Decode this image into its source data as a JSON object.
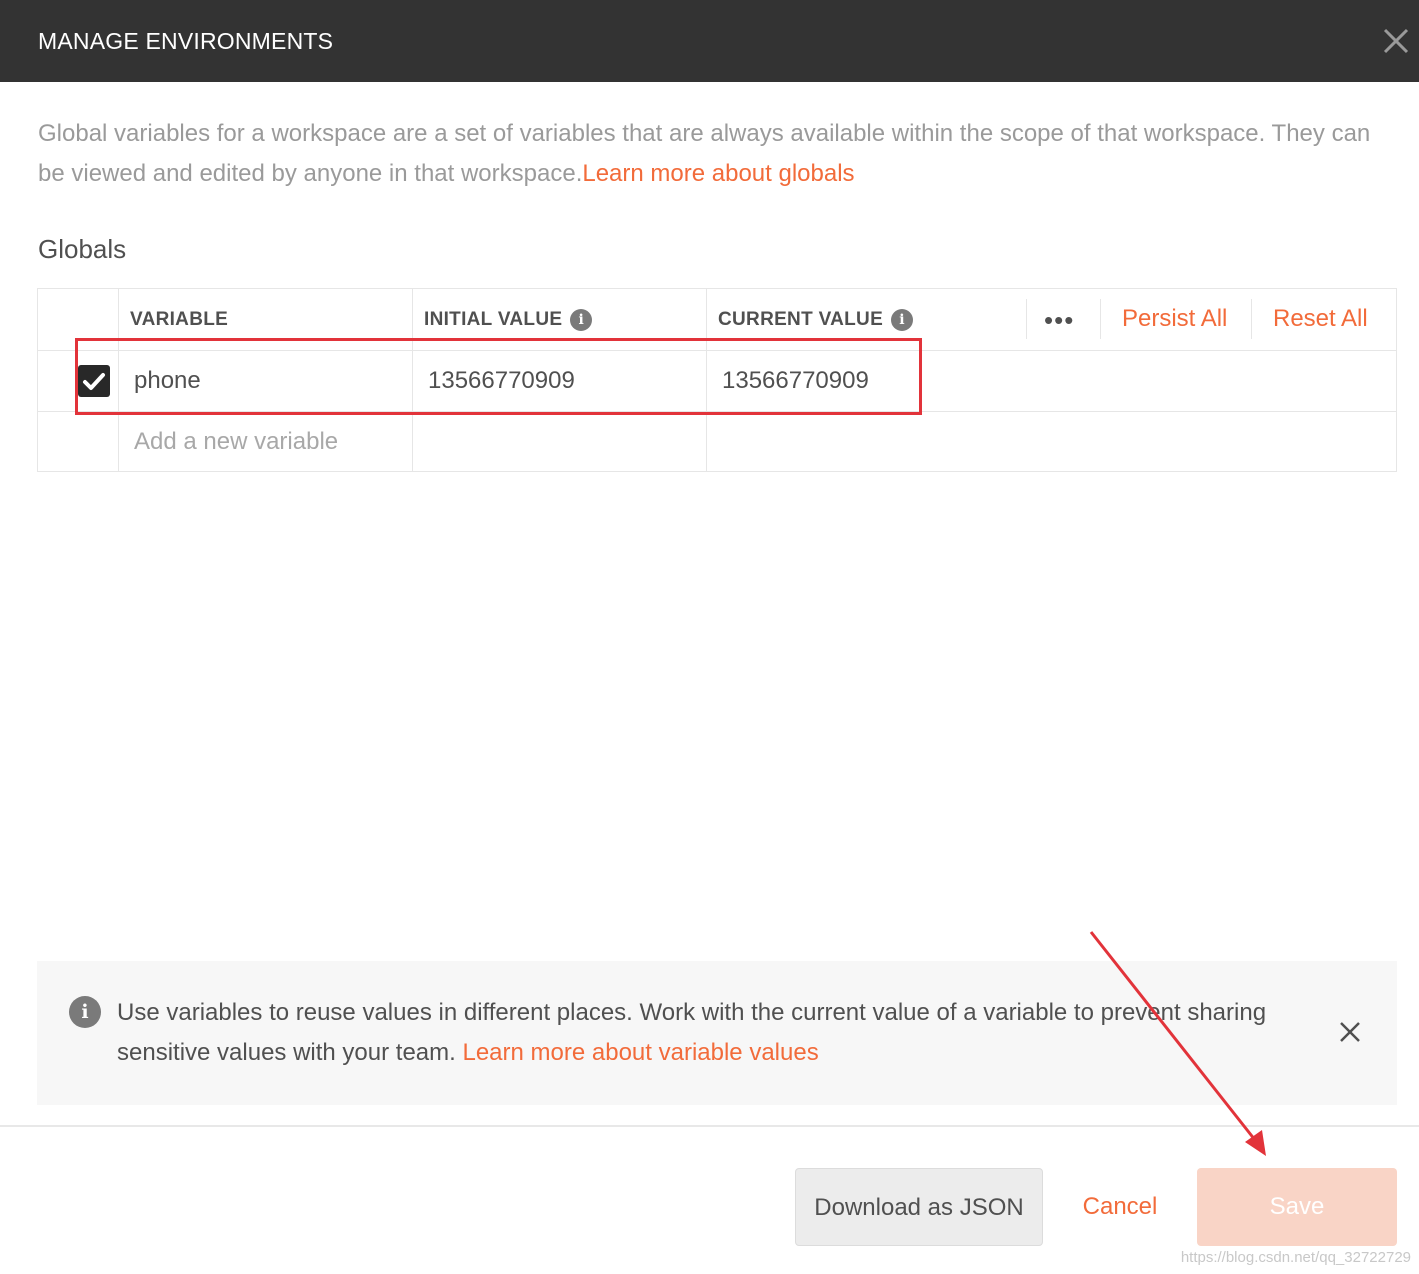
{
  "dialog": {
    "title": "MANAGE ENVIRONMENTS",
    "close_icon": "close-icon"
  },
  "intro": {
    "text": "Global variables for a workspace are a set of variables that are always available within the scope of that workspace. They can be viewed and edited by anyone in that workspace.",
    "link": "Learn more about globals"
  },
  "section_title": "Globals",
  "table": {
    "columns": {
      "variable": "VARIABLE",
      "initial_value": "INITIAL VALUE",
      "current_value": "CURRENT VALUE"
    },
    "info_icon": "i",
    "more_icon": "•••",
    "actions": {
      "persist_all": "Persist All",
      "reset_all": "Reset All"
    },
    "rows": [
      {
        "checked": true,
        "variable": "phone",
        "initial_value": "13566770909",
        "current_value": "13566770909"
      }
    ],
    "new_variable_placeholder": "Add a new variable"
  },
  "infobox": {
    "icon": "i",
    "text": "Use variables to reuse values in different places. Work with the current value of a variable to prevent sharing sensitive values with your team.",
    "link": "Learn more about variable values"
  },
  "footer": {
    "download_label": "Download as JSON",
    "cancel_label": "Cancel",
    "save_label": "Save"
  },
  "watermark": "https://blog.csdn.net/qq_32722729",
  "colors": {
    "accent": "#f26b3a",
    "titlebar": "#333333",
    "annotation": "#e2333a",
    "save_disabled": "#f9d4c6"
  }
}
